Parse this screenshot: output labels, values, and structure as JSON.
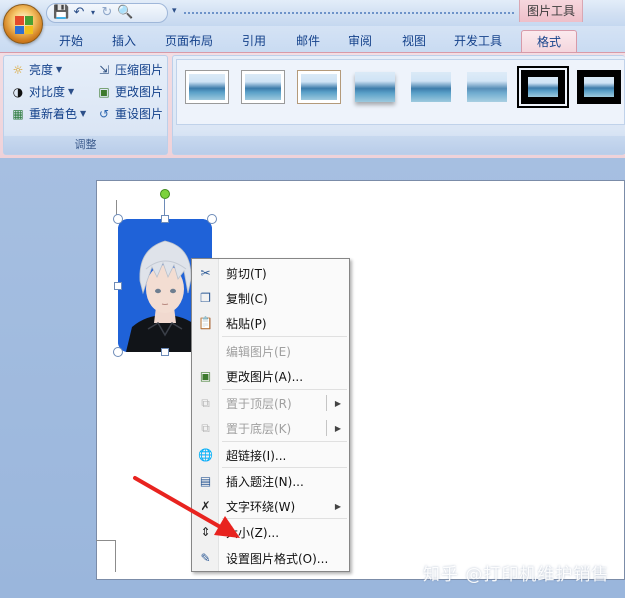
{
  "titlebar": {
    "context_tool_title": "图片工具"
  },
  "tabs": [
    {
      "label": "开始"
    },
    {
      "label": "插入"
    },
    {
      "label": "页面布局"
    },
    {
      "label": "引用"
    },
    {
      "label": "邮件"
    },
    {
      "label": "审阅"
    },
    {
      "label": "视图"
    },
    {
      "label": "开发工具"
    },
    {
      "label": "格式",
      "active": true
    }
  ],
  "ribbon": {
    "adjust_group": {
      "label": "调整",
      "brightness": "亮度",
      "contrast": "对比度",
      "recolor": "重新着色",
      "compress": "压缩图片",
      "change_picture": "更改图片",
      "reset_picture": "重设图片"
    },
    "picture_styles_count": 8
  },
  "context_menu": {
    "items": [
      {
        "label": "剪切(T)",
        "icon": "scissors-icon",
        "enabled": true
      },
      {
        "label": "复制(C)",
        "icon": "copy-icon",
        "enabled": true
      },
      {
        "label": "粘贴(P)",
        "icon": "paste-icon",
        "enabled": true
      },
      {
        "label": "编辑图片(E)",
        "enabled": false
      },
      {
        "label": "更改图片(A)...",
        "icon": "change-picture-icon",
        "enabled": true
      },
      {
        "label": "置于顶层(R)",
        "icon": "bring-to-front-icon",
        "enabled": false,
        "submenu": true
      },
      {
        "label": "置于底层(K)",
        "icon": "send-to-back-icon",
        "enabled": false,
        "submenu": true
      },
      {
        "label": "超链接(I)...",
        "icon": "hyperlink-icon",
        "enabled": true
      },
      {
        "label": "插入题注(N)...",
        "icon": "caption-icon",
        "enabled": true
      },
      {
        "label": "文字环绕(W)",
        "icon": "text-wrap-icon",
        "enabled": true,
        "submenu": true
      },
      {
        "label": "大小(Z)...",
        "icon": "size-icon",
        "enabled": true
      },
      {
        "label": "设置图片格式(O)...",
        "icon": "format-picture-icon",
        "enabled": true
      }
    ]
  },
  "watermark": "知乎 @打印机维护销售",
  "colors": {
    "annotation_arrow": "#e8231f",
    "contextual_tab": "#f4d6dd"
  }
}
